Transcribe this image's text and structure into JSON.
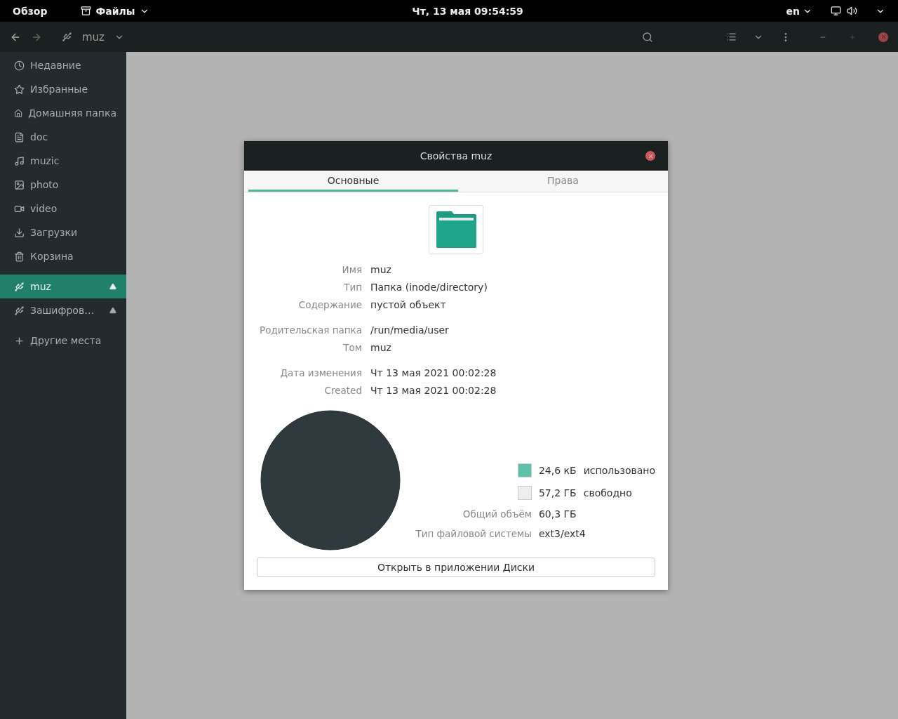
{
  "top_bar": {
    "activities": "Обзор",
    "app_menu": "Файлы",
    "clock": "Чт, 13 мая  09:54:59",
    "language": "en"
  },
  "header_bar": {
    "path": "muz"
  },
  "sidebar": {
    "sections": [
      [
        {
          "kind": "recent",
          "label": "Недавние",
          "selected": false
        },
        {
          "kind": "starred",
          "label": "Избранные",
          "selected": false
        },
        {
          "kind": "home",
          "label": "Домашняя папка",
          "selected": false
        },
        {
          "kind": "document",
          "label": "doc",
          "selected": false
        },
        {
          "kind": "music",
          "label": "muzic",
          "selected": false
        },
        {
          "kind": "picture",
          "label": "photo",
          "selected": false
        },
        {
          "kind": "video",
          "label": "video",
          "selected": false
        },
        {
          "kind": "download",
          "label": "Загрузки",
          "selected": false
        },
        {
          "kind": "trash",
          "label": "Корзина",
          "selected": false
        }
      ],
      [
        {
          "kind": "drive",
          "label": "muz",
          "selected": true
        },
        {
          "kind": "drive",
          "label": "Зашифров…",
          "selected": false
        }
      ],
      [
        {
          "kind": "other",
          "label": "Другие места",
          "selected": false
        }
      ]
    ]
  },
  "dialog": {
    "title": "Свойства muz",
    "tabs": [
      {
        "label": "Основные",
        "selected": true
      },
      {
        "label": "Права",
        "selected": false
      }
    ],
    "info_groups": [
      [
        {
          "label": "Имя",
          "value": "muz"
        },
        {
          "label": "Тип",
          "value": "Папка (inode/directory)"
        },
        {
          "label": "Содержание",
          "value": "пустой объект"
        }
      ],
      [
        {
          "label": "Родительская папка",
          "value": "/run/media/user"
        },
        {
          "label": "Том",
          "value": "muz"
        }
      ],
      [
        {
          "label": "Дата изменения",
          "value": "Чт 13 мая 2021 00:02:28"
        },
        {
          "label": "Created",
          "value": "Чт 13 мая 2021 00:02:28"
        }
      ]
    ],
    "legend": [
      {
        "color": "#5fc1ab",
        "amount": "24,6 кБ",
        "label": "использовано"
      },
      {
        "color": "#eeeeee",
        "amount": "57,2 ГБ",
        "label": "свободно"
      }
    ],
    "totals": [
      {
        "label": "Общий объём",
        "value": "60,3 ГБ"
      },
      {
        "label": "Тип файловой системы",
        "value": "ext3/ext4"
      }
    ],
    "open_button": "Открыть в приложении Диски"
  }
}
